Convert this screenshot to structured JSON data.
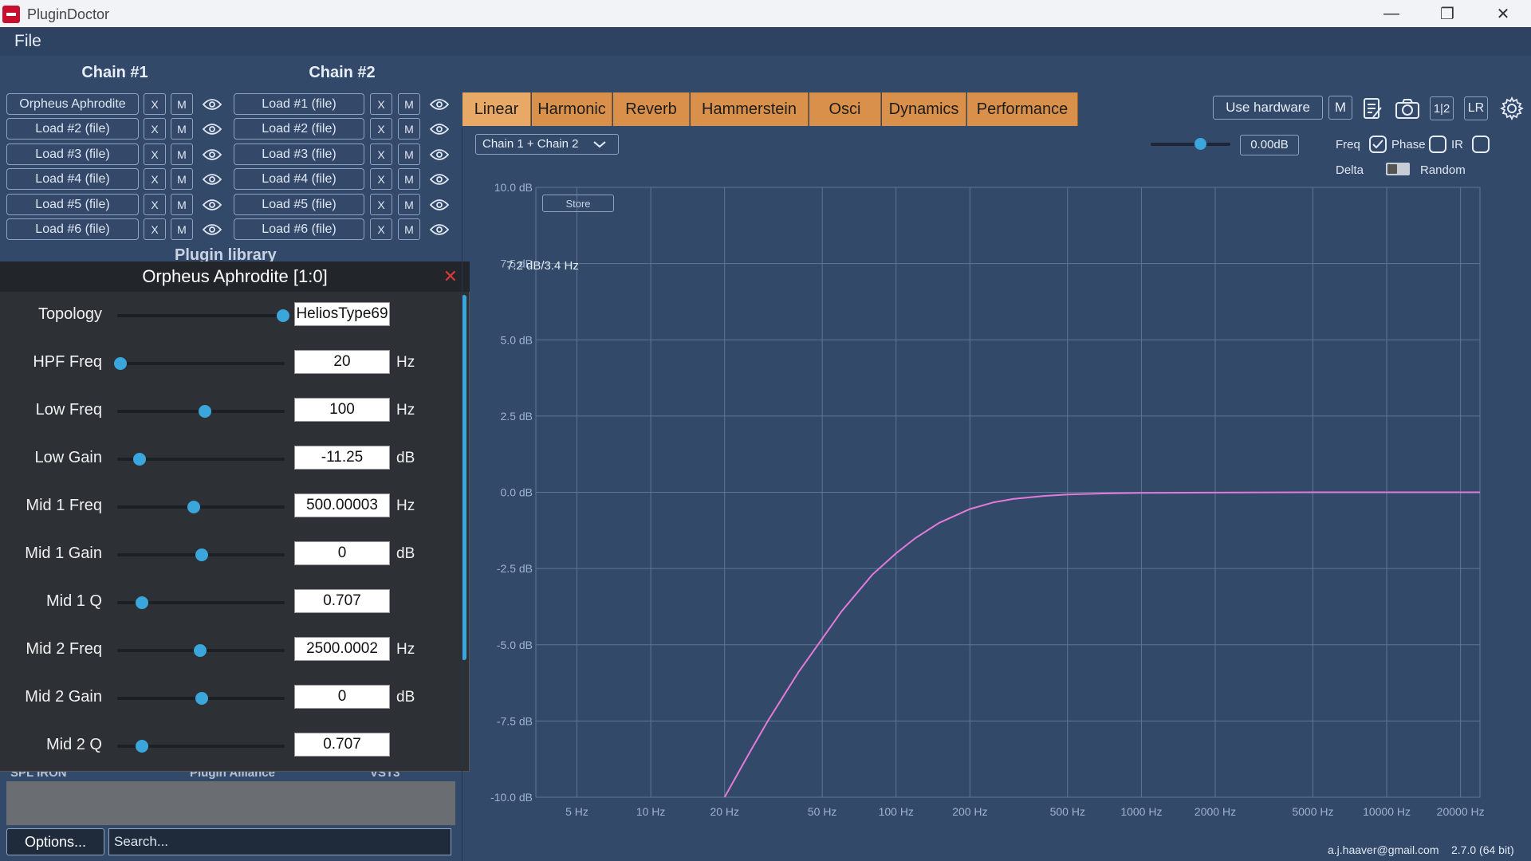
{
  "window": {
    "title": "PluginDoctor",
    "minimize": "—",
    "restore": "❐",
    "close": "✕"
  },
  "menu": {
    "file": "File"
  },
  "chains": [
    {
      "title": "Chain #1",
      "slots": [
        "Orpheus Aphrodite",
        "Load #2 (file)",
        "Load #3 (file)",
        "Load #4 (file)",
        "Load #5 (file)",
        "Load #6 (file)"
      ]
    },
    {
      "title": "Chain #2",
      "slots": [
        "Load #1 (file)",
        "Load #2 (file)",
        "Load #3 (file)",
        "Load #4 (file)",
        "Load #5 (file)",
        "Load #6 (file)"
      ]
    }
  ],
  "slot_buttons": {
    "remove": "X",
    "mute": "M"
  },
  "plugin_library": {
    "heading": "Plugin library",
    "columns": [
      "SPL IRON",
      "Plugin Alliance",
      "VST3"
    ],
    "options_label": "Options...",
    "search_placeholder": "Search..."
  },
  "plugin_window": {
    "title": "Orpheus Aphrodite [1:0]",
    "close": "✕",
    "params": [
      {
        "label": "Topology",
        "value": "HeliosType69",
        "unit": "",
        "slider": 1.0
      },
      {
        "label": "HPF Freq",
        "value": "20",
        "unit": "Hz",
        "slider": 0.0
      },
      {
        "label": "Low Freq",
        "value": "100",
        "unit": "Hz",
        "slider": 0.52
      },
      {
        "label": "Low Gain",
        "value": "-11.25",
        "unit": "dB",
        "slider": 0.12
      },
      {
        "label": "Mid 1 Freq",
        "value": "500.00003",
        "unit": "Hz",
        "slider": 0.45
      },
      {
        "label": "Mid 1 Gain",
        "value": "0",
        "unit": "dB",
        "slider": 0.5
      },
      {
        "label": "Mid 1 Q",
        "value": "0.707",
        "unit": "",
        "slider": 0.13
      },
      {
        "label": "Mid 2 Freq",
        "value": "2500.0002",
        "unit": "Hz",
        "slider": 0.49
      },
      {
        "label": "Mid 2 Gain",
        "value": "0",
        "unit": "dB",
        "slider": 0.5
      },
      {
        "label": "Mid 2 Q",
        "value": "0.707",
        "unit": "",
        "slider": 0.13
      }
    ]
  },
  "tabs": [
    "Linear",
    "Harmonic",
    "Reverb",
    "Hammerstein",
    "Osci",
    "Dynamics",
    "Performance"
  ],
  "active_tab": "Linear",
  "toolbar": {
    "use_hardware": "Use hardware",
    "mute": "M",
    "one_two": "1|2",
    "lr": "LR"
  },
  "controls": {
    "chain_select": "Chain 1 + Chain 2",
    "gain_value": "0.00dB",
    "gain_slider": 0.62,
    "freq_label": "Freq",
    "freq_checked": true,
    "phase_label": "Phase",
    "phase_checked": false,
    "ir_label": "IR",
    "ir_checked": false,
    "delta_label": "Delta",
    "random_label": "Random",
    "store_label": "Store"
  },
  "readout": "7.2 dB/3.4 Hz",
  "footer": {
    "email": "a.j.haaver@gmail.com",
    "version": "2.7.0 (64 bit)"
  },
  "colors": {
    "accent": "#3aa6dc",
    "tab": "#d9904a",
    "curve": "#e37ad8",
    "plot_bg": "#33496a",
    "grid": "#5c7797"
  },
  "chart_data": {
    "type": "line",
    "title": "",
    "xlabel": "",
    "ylabel": "",
    "x_scale": "log",
    "xlim": [
      3.4,
      24000
    ],
    "ylim": [
      -10,
      10
    ],
    "x_ticks": [
      5,
      10,
      20,
      50,
      100,
      200,
      500,
      1000,
      2000,
      5000,
      10000,
      20000
    ],
    "x_tick_labels": [
      "5 Hz",
      "10 Hz",
      "20 Hz",
      "50 Hz",
      "100 Hz",
      "200 Hz",
      "500 Hz",
      "1000 Hz",
      "2000 Hz",
      "5000 Hz",
      "10000 Hz",
      "20000 Hz"
    ],
    "y_ticks": [
      10,
      7.5,
      5,
      2.5,
      0,
      -2.5,
      -5,
      -7.5,
      -10
    ],
    "y_tick_labels": [
      "10.0 dB",
      "7.5 dB",
      "5.0 dB",
      "2.5 dB",
      "0.0 dB",
      "-2.5 dB",
      "-5.0 dB",
      "-7.5 dB",
      "-10.0 dB"
    ],
    "grid": true,
    "series": [
      {
        "color": "#e37ad8",
        "x": [
          20,
          25,
          30,
          40,
          50,
          60,
          80,
          100,
          120,
          150,
          200,
          250,
          300,
          400,
          500,
          700,
          1000,
          2000,
          5000,
          10000,
          24000
        ],
        "y": [
          -10,
          -8.6,
          -7.5,
          -5.9,
          -4.8,
          -3.9,
          -2.7,
          -2.0,
          -1.5,
          -1.0,
          -0.55,
          -0.33,
          -0.22,
          -0.12,
          -0.07,
          -0.04,
          -0.02,
          -0.01,
          0,
          0,
          0
        ]
      }
    ]
  }
}
